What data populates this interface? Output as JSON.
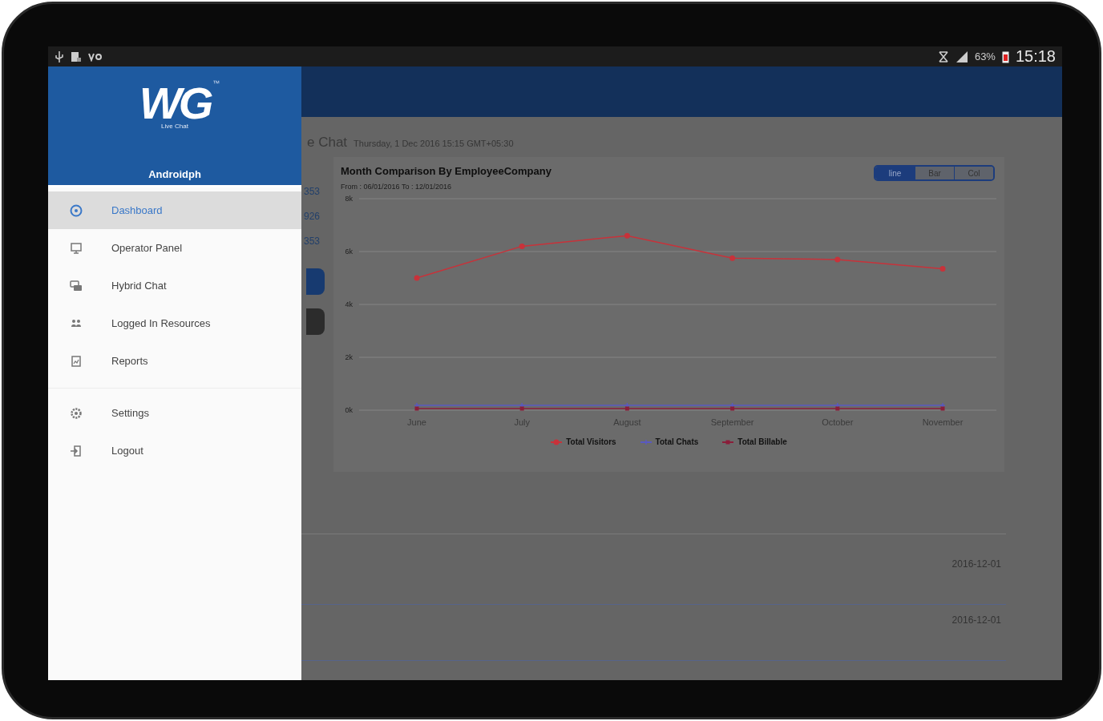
{
  "status_bar": {
    "battery": "63%",
    "time": "15:18"
  },
  "drawer": {
    "logo": "WG",
    "trademark": "™",
    "logo_caption": "Live Chat",
    "user": "Androidph",
    "primary": [
      {
        "label": "Dashboard",
        "selected": true
      },
      {
        "label": "Operator Panel",
        "selected": false
      },
      {
        "label": "Hybrid Chat",
        "selected": false
      },
      {
        "label": "Logged In Resources",
        "selected": false
      },
      {
        "label": "Reports",
        "selected": false
      }
    ],
    "secondary": [
      {
        "label": "Settings",
        "selected": false
      },
      {
        "label": "Logout",
        "selected": false
      }
    ]
  },
  "page": {
    "title": "e Chat",
    "date": "Thursday, 1 Dec 2016 15:15 GMT+05:30",
    "stats": [
      "353",
      "926",
      "353"
    ],
    "chart_card": {
      "title": "Month Comparison By EmployeeCompany",
      "subtitle": "From : 06/01/2016 To : 12/01/2016",
      "chart_types": [
        {
          "label": "line",
          "selected": true
        },
        {
          "label": "Bar",
          "selected": false
        },
        {
          "label": "Col",
          "selected": false
        }
      ],
      "chart_data": {
        "type": "line",
        "categories": [
          "June",
          "July",
          "August",
          "September",
          "October",
          "November"
        ],
        "grid": true,
        "ylim": [
          0,
          8000
        ],
        "yticks": [
          {
            "value": 0,
            "label": "0k"
          },
          {
            "value": 2000,
            "label": "2k"
          },
          {
            "value": 4000,
            "label": "4k"
          },
          {
            "value": 6000,
            "label": "6k"
          },
          {
            "value": 8000,
            "label": "8k"
          }
        ],
        "series": [
          {
            "name": "Total Visitors",
            "color": "#c8323a",
            "marker": "circle",
            "values": [
              5000,
              6200,
              6600,
              5750,
              5700,
              5350
            ]
          },
          {
            "name": "Total Chats",
            "color": "#5a5ac0",
            "marker": "cross",
            "values": [
              180,
              180,
              180,
              180,
              180,
              180
            ]
          },
          {
            "name": "Total Billable",
            "color": "#8a1e3a",
            "marker": "square",
            "values": [
              60,
              60,
              60,
              60,
              60,
              60
            ]
          }
        ]
      }
    },
    "rows": [
      {
        "date": "2016-12-01"
      },
      {
        "date": "2016-12-01"
      }
    ]
  }
}
